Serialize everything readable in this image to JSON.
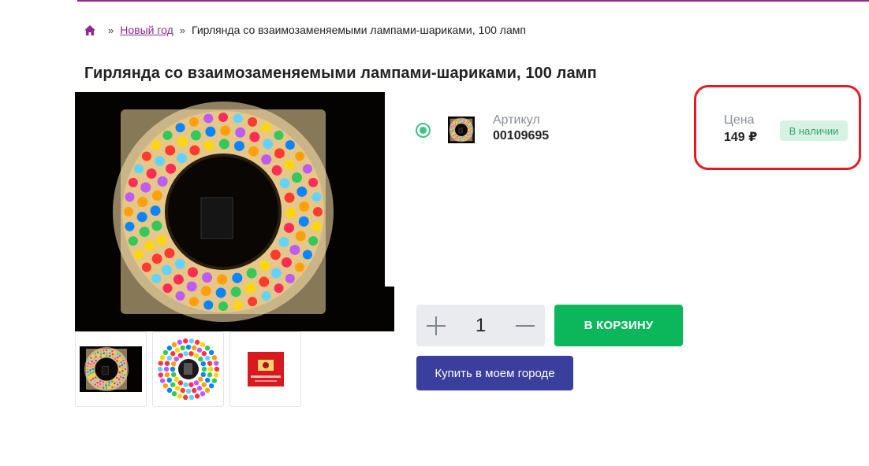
{
  "breadcrumb": {
    "home_icon": "home-icon",
    "separator": "»",
    "category": "Новый год",
    "current": "Гирлянда со взаимозаменяемыми лампами-шариками, 100 ламп"
  },
  "product": {
    "title": "Гирлянда со взаимозаменяемыми лампами-шариками, 100 ламп",
    "article_label": "Артикул",
    "article_value": "00109695",
    "price_label": "Цена",
    "price_value": "149 ₽",
    "stock_status": "В наличии"
  },
  "purchase": {
    "quantity": "1",
    "cart_button": "В КОРЗИНУ",
    "city_button": "Купить в моем городе"
  },
  "colors": {
    "accent_purple": "#8e2a8a",
    "green": "#0cb75b",
    "indigo": "#3a3f9d",
    "highlight_red": "#e51b23"
  }
}
